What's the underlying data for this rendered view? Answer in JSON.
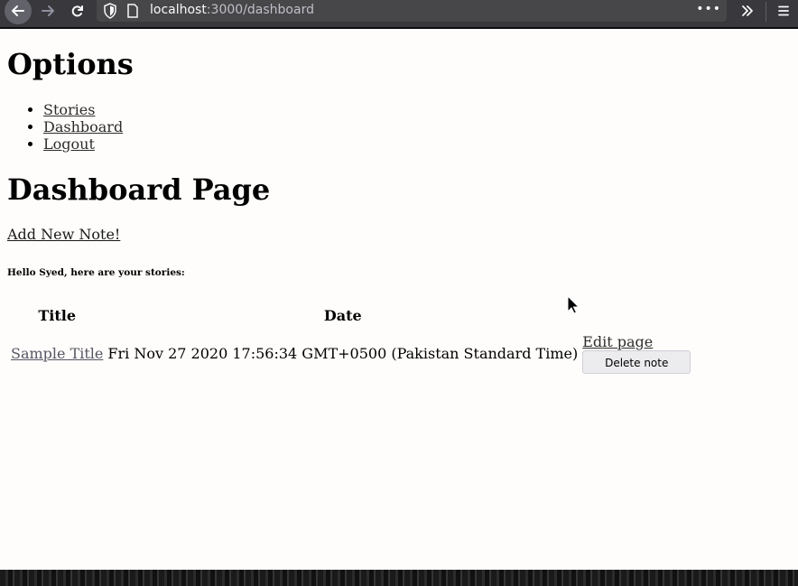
{
  "browser": {
    "url_host": "localhost",
    "url_path": ":3000/dashboard",
    "more_dots": "•••"
  },
  "options": {
    "heading": "Options",
    "nav": [
      {
        "label": "Stories"
      },
      {
        "label": "Dashboard"
      },
      {
        "label": "Logout"
      }
    ]
  },
  "dashboard": {
    "heading": "Dashboard Page",
    "add_note_label": "Add New Note!",
    "greeting": "Hello Syed, here are your stories:",
    "table": {
      "headers": [
        "Title",
        "Date"
      ],
      "rows": [
        {
          "title": "Sample Title",
          "date": "Fri Nov 27 2020 17:56:34 GMT+0500 (Pakistan Standard Time)",
          "edit_label": "Edit page",
          "delete_label": "Delete note"
        }
      ]
    }
  }
}
